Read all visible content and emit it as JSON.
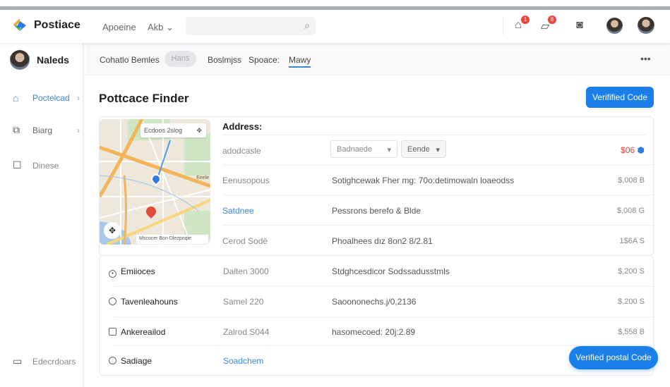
{
  "header": {
    "brand": "Postiace",
    "nav": [
      "Apoeine",
      "Akb"
    ],
    "search_placeholder": "",
    "badges": [
      "1",
      "8"
    ]
  },
  "sidebar": {
    "user": "Naleds",
    "items": [
      {
        "label": "Poctelcad",
        "icon": "home-icon"
      },
      {
        "label": "Biarg",
        "icon": "inbox-icon"
      },
      {
        "label": "Dinese",
        "icon": "square-icon"
      }
    ],
    "bottom_item": "Edecrdoars"
  },
  "subnav": {
    "items": [
      "Cohatlo Bemles",
      "Hans",
      "Boslmjss",
      "Spoace:",
      "Mawy"
    ],
    "active": "Mawy"
  },
  "page": {
    "title": "Pottcace Finder",
    "verify_button": "Verifified Code",
    "float_button": "Verified postal Code"
  },
  "map": {
    "search_chip": "Ecdoos 2slog",
    "attribution": "Mscocer Bon Dlezpnqie",
    "road_label": "Eeele"
  },
  "address": {
    "heading": "Address:",
    "row0_label": "adodcasle",
    "select1": "Badnaede",
    "select2": "Eende",
    "row0_price": "$06",
    "rows": [
      {
        "label": "Eenusopous",
        "value": "Sotighcewak Fher mg: 70o:detimowaln loaeodss",
        "price": "$,008 B"
      },
      {
        "label": "Satdnee",
        "value": "Pessrons berefo & Blde",
        "price": "$,008 G"
      },
      {
        "label": "Cerod Sodē",
        "value": "Phoalhees dız 8on2 8/2.81",
        "price": "1$6A S"
      }
    ]
  },
  "list": [
    {
      "name": "Emiioces",
      "code": "Dalten 3000",
      "value": "Stdghcesdicor Sodssadusstmls",
      "price": "$,200 S",
      "control": "radio-checked"
    },
    {
      "name": "Tavenleahouns",
      "code": "Samel 220",
      "value": "Saoononechs.j/0,2136",
      "price": "$,200 S",
      "control": "radio"
    },
    {
      "name": "Ankereailod",
      "code": "Zalrod S044",
      "value": "hasomecoed: 20j:2.89",
      "price": "$,558 B",
      "control": "checkbox"
    },
    {
      "name": "Sadiage",
      "code": "Soadchem",
      "value": "",
      "price": "",
      "control": "radio"
    }
  ],
  "colors": {
    "accent": "#1a7fe8",
    "price_alert": "#e8453c",
    "link": "#3a86d6"
  }
}
